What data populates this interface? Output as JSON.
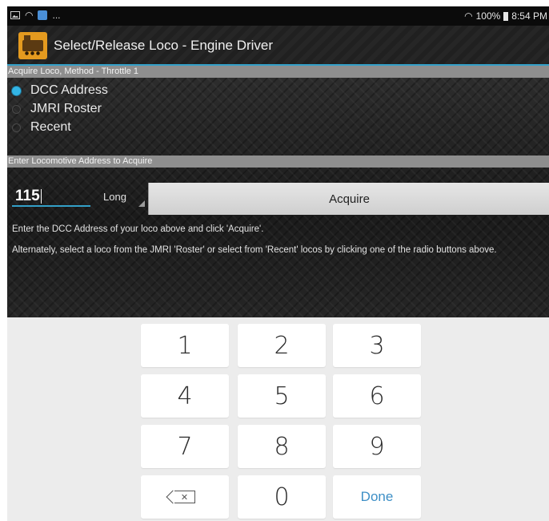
{
  "status_bar": {
    "ellipsis": "...",
    "battery": "100%",
    "time": "8:54 PM"
  },
  "app_bar": {
    "title": "Select/Release Loco - Engine Driver"
  },
  "acquire_section": {
    "header": "Acquire Loco, Method - Throttle 1",
    "options": [
      {
        "label": "DCC Address",
        "selected": true
      },
      {
        "label": "JMRI Roster",
        "selected": false
      },
      {
        "label": "Recent",
        "selected": false
      }
    ]
  },
  "address_section": {
    "header": "Enter Locomotive Address to Acquire",
    "address_value": "115",
    "address_type": "Long",
    "acquire_label": "Acquire"
  },
  "help": {
    "line1": "Enter the DCC Address of your loco above and click 'Acquire'.",
    "line2": "Alternately, select a loco from the JMRI 'Roster' or select from 'Recent' locos by clicking one of the radio buttons above."
  },
  "keyboard": {
    "keys": [
      "1",
      "2",
      "3",
      "4",
      "5",
      "6",
      "7",
      "8",
      "9",
      "0"
    ],
    "done_label": "Done",
    "backspace_icon": "backspace-icon"
  },
  "colors": {
    "accent": "#33b5e5",
    "done_text": "#3d8fc6"
  }
}
